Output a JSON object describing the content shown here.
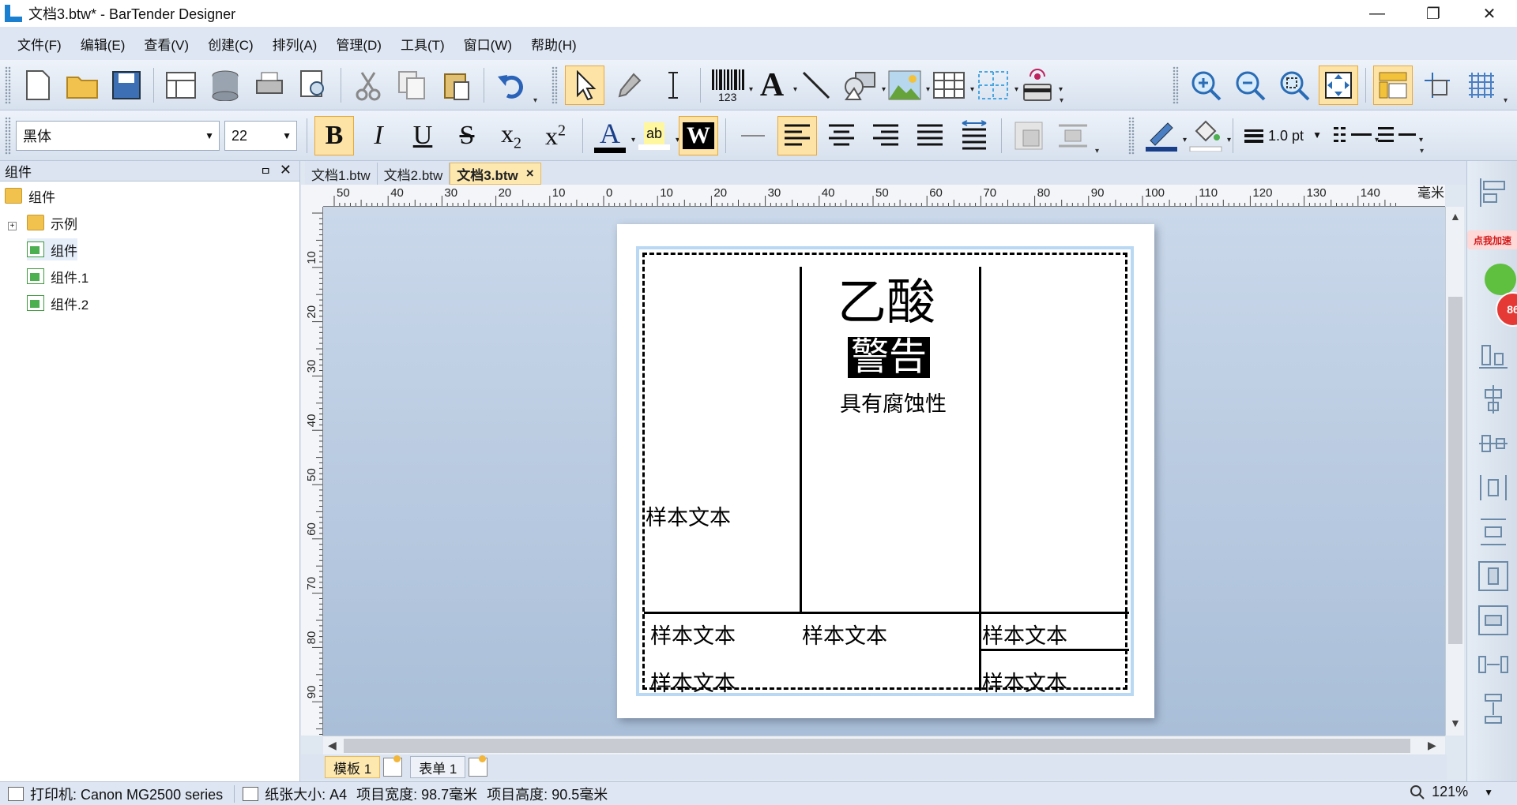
{
  "window": {
    "title": "文档3.btw* - BarTender Designer",
    "minimize": "—",
    "restore": "❐",
    "close": "✕"
  },
  "menu": [
    "文件(F)",
    "编辑(E)",
    "查看(V)",
    "创建(C)",
    "排列(A)",
    "管理(D)",
    "工具(T)",
    "窗口(W)",
    "帮助(H)"
  ],
  "format_toolbar": {
    "font_name": "黑体",
    "font_size": "22",
    "bold": "B",
    "italic": "I",
    "underline": "U",
    "strike": "S",
    "subscript": "x",
    "subscript_small": "2",
    "superscript": "x",
    "superscript_small": "2",
    "font_color": "A",
    "highlight": "ab",
    "word_style": "W",
    "line_width": "1.0 pt"
  },
  "object_toolbar": {
    "barcode_number": "123",
    "text_tool": "A"
  },
  "components_panel": {
    "title": "组件",
    "pin": "ㅁ",
    "close": "✕",
    "root": "组件",
    "expander": "+",
    "items": [
      "示例",
      "组件",
      "组件.1",
      "组件.2"
    ]
  },
  "doc_tabs": [
    {
      "label": "文档1.btw"
    },
    {
      "label": "文档2.btw"
    },
    {
      "label": "文档3.btw",
      "active": true
    }
  ],
  "active_tab_close": "×",
  "ruler": {
    "h_labels": [
      "50",
      "40",
      "30",
      "20",
      "10",
      "0",
      "10",
      "20",
      "30",
      "40",
      "50",
      "60",
      "70",
      "80",
      "90",
      "100",
      "110",
      "120",
      "130",
      "140"
    ],
    "unit": "毫米",
    "v_labels": [
      "10",
      "20",
      "30",
      "40",
      "50",
      "60",
      "70",
      "80",
      "90"
    ]
  },
  "label": {
    "title": "乙酸",
    "warning": "警告",
    "subtitle": "具有腐蚀性",
    "sample_text": "样本文本"
  },
  "sheet_tabs": [
    "模板 1",
    "表单 1"
  ],
  "right_strip": {
    "promo": "点我加速",
    "badge": "86"
  },
  "status": {
    "printer": "打印机: Canon MG2500 series",
    "paper": "纸张大小: A4",
    "item_width": "项目宽度: 98.7毫米",
    "item_height": "项目高度: 90.5毫米",
    "zoom": "121%"
  }
}
